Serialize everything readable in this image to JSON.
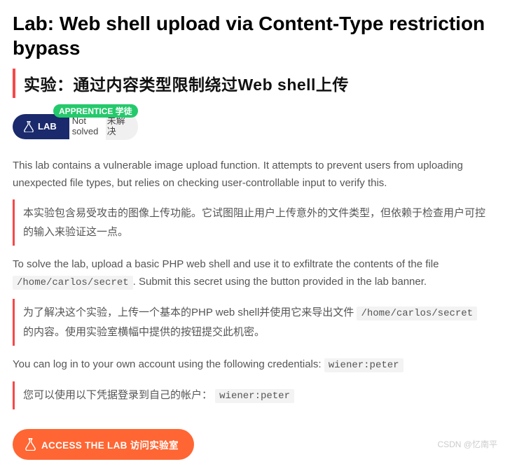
{
  "title_en": "Lab: Web shell upload via Content-Type restriction bypass",
  "title_cn": "实验：通过内容类型限制绕过Web shell上传",
  "badge": "APPRENTICE 学徒",
  "lab_pill": "LAB",
  "status_en": "Not solved",
  "status_cn": "未解决",
  "p1_en": "This lab contains a vulnerable image upload function. It attempts to prevent users from uploading unexpected file types, but relies on checking user-controllable input to verify this.",
  "p1_cn": "本实验包含易受攻击的图像上传功能。它试图阻止用户上传意外的文件类型，但依赖于检查用户可控的输入来验证这一点。",
  "p2_en_a": "To solve the lab, upload a basic PHP web shell and use it to exfiltrate the contents of the file ",
  "p2_en_b": ". Submit this secret using the button provided in the lab banner.",
  "p2_cn_a": "为了解决这个实验，上传一个基本的PHP web shell并使用它来导出文件 ",
  "p2_cn_b": " 的内容。使用实验室横幅中提供的按钮提交此机密。",
  "secret_path": "/home/carlos/secret",
  "p3_en": "You can log in to your own account using the following credentials: ",
  "p3_cn": "您可以使用以下凭据登录到自己的帐户： ",
  "creds": "wiener:peter",
  "access_btn": "ACCESS THE LAB 访问实验室",
  "watermark": "CSDN @忆南平"
}
